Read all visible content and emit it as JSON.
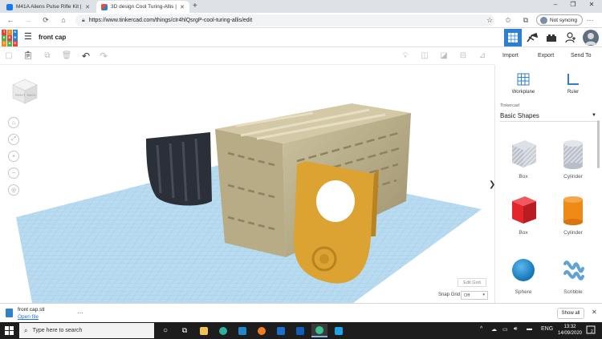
{
  "browser": {
    "tabs": [
      {
        "title": "M41A Aliens Pulse Rifle Kit | Face",
        "favicon_color": "#1877f2",
        "active": false
      },
      {
        "title": "3D design Cool Turing-Allis | Tin",
        "favicon_color": "#e5522f",
        "active": true
      }
    ],
    "new_tab_label": "+",
    "window_controls": [
      "–",
      "❐",
      "✕"
    ],
    "url": "https://www.tinkercad.com/things/cIr4hlQsrgP-cool-turing-allis/edit",
    "sync_label": "Not syncing"
  },
  "app": {
    "logo_letters": [
      "TIN",
      "KER",
      "CAD"
    ],
    "logo_colors": [
      "#e8403b",
      "#f18a21",
      "#2d7fd0",
      "#4db34d",
      "#e8403b",
      "#2d7fd0",
      "#f18a21",
      "#4db34d",
      "#e8403b"
    ],
    "design_name": "front cap",
    "accent_color": "#2d7fd0"
  },
  "toolbar": {
    "import_label": "Import",
    "export_label": "Export",
    "sendto_label": "Send To"
  },
  "viewport": {
    "viewcube_faces": [
      "RIGHT",
      "BACK"
    ],
    "edit_grid_label": "Edit Grid",
    "snap_grid_label": "Snap Grid",
    "snap_grid_value": "Off",
    "collapse_glyph": "❯"
  },
  "panel": {
    "workplane_label": "Workplane",
    "ruler_label": "Ruler",
    "library_small": "Tinkercad",
    "library_value": "Basic Shapes",
    "shapes": [
      {
        "label": "Box",
        "kind": "hole-box"
      },
      {
        "label": "Cylinder",
        "kind": "hole-cylinder"
      },
      {
        "label": "Box",
        "kind": "box"
      },
      {
        "label": "Cylinder",
        "kind": "cylinder"
      },
      {
        "label": "Sphere",
        "kind": "sphere"
      },
      {
        "label": "Scribble",
        "kind": "scribble"
      }
    ],
    "colors": {
      "box": "#e2262b",
      "cylinder": "#f08a17",
      "sphere": "#1a8fd6",
      "scribble": "#5fa3d6"
    }
  },
  "download": {
    "file_name": "front cap.stl",
    "open_label": "Open file",
    "more_label": "···",
    "show_all_label": "Show all",
    "close_label": "✕"
  },
  "taskbar": {
    "search_placeholder": "Type here to search",
    "language": "ENG",
    "time": "13:32",
    "date": "14/09/2020",
    "notification_count": "2"
  },
  "model_colors": {
    "frame": "#b8ac86",
    "cap": "#dca232",
    "gripper": "#2a2f38",
    "grid": "#a8cfe7"
  }
}
